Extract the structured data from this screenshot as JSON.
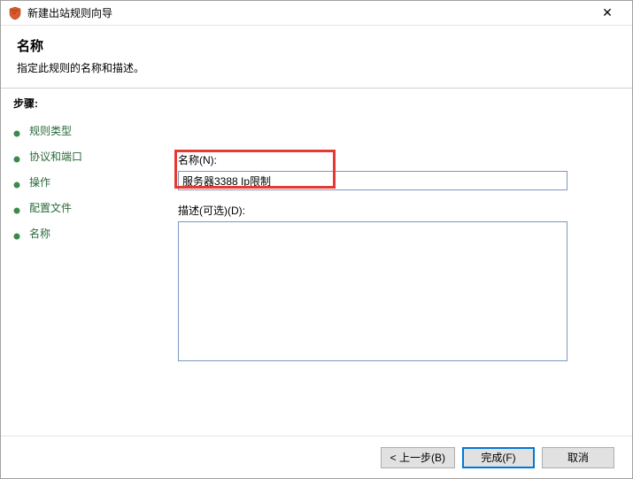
{
  "window": {
    "title": "新建出站规则向导",
    "close_symbol": "✕"
  },
  "header": {
    "title": "名称",
    "subtitle": "指定此规则的名称和描述。"
  },
  "sidebar": {
    "heading": "步骤:",
    "items": [
      {
        "label": "规则类型"
      },
      {
        "label": "协议和端口"
      },
      {
        "label": "操作"
      },
      {
        "label": "配置文件"
      },
      {
        "label": "名称"
      }
    ]
  },
  "form": {
    "name_label": "名称(N):",
    "name_value": "服务器3388 Ip限制",
    "desc_label": "描述(可选)(D):",
    "desc_value": ""
  },
  "footer": {
    "back": "< 上一步(B)",
    "finish": "完成(F)",
    "cancel": "取消"
  }
}
